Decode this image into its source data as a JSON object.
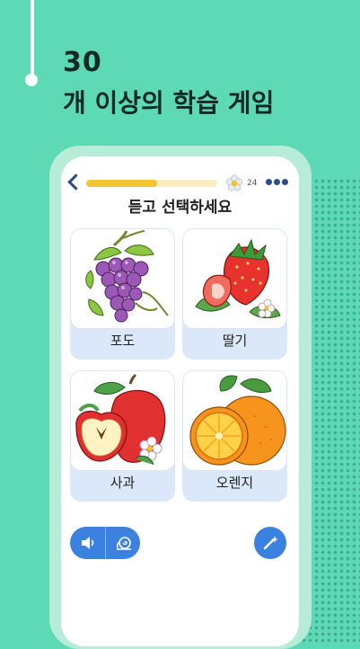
{
  "headline": {
    "line1": "30",
    "line2": "개 이상의 학습 게임"
  },
  "game": {
    "progress": 0.54,
    "flower_count": "24",
    "prompt": "듣고 선택하세요",
    "options": [
      {
        "label": "포도",
        "icon": "grapes-icon"
      },
      {
        "label": "딸기",
        "icon": "strawberry-icon"
      },
      {
        "label": "사과",
        "icon": "apple-icon"
      },
      {
        "label": "오렌지",
        "icon": "orange-icon"
      }
    ],
    "icons": {
      "back": "chevron-left-icon",
      "coins": "flower-icon",
      "menu": "more-dots-icon",
      "audio": "speaker-icon",
      "slow_audio": "snail-icon",
      "hint": "magic-wand-icon"
    }
  },
  "colors": {
    "background": "#5dd9b6",
    "accent": "#3b82e0",
    "progress": "#f2c531",
    "card": "#dbe8fa"
  }
}
